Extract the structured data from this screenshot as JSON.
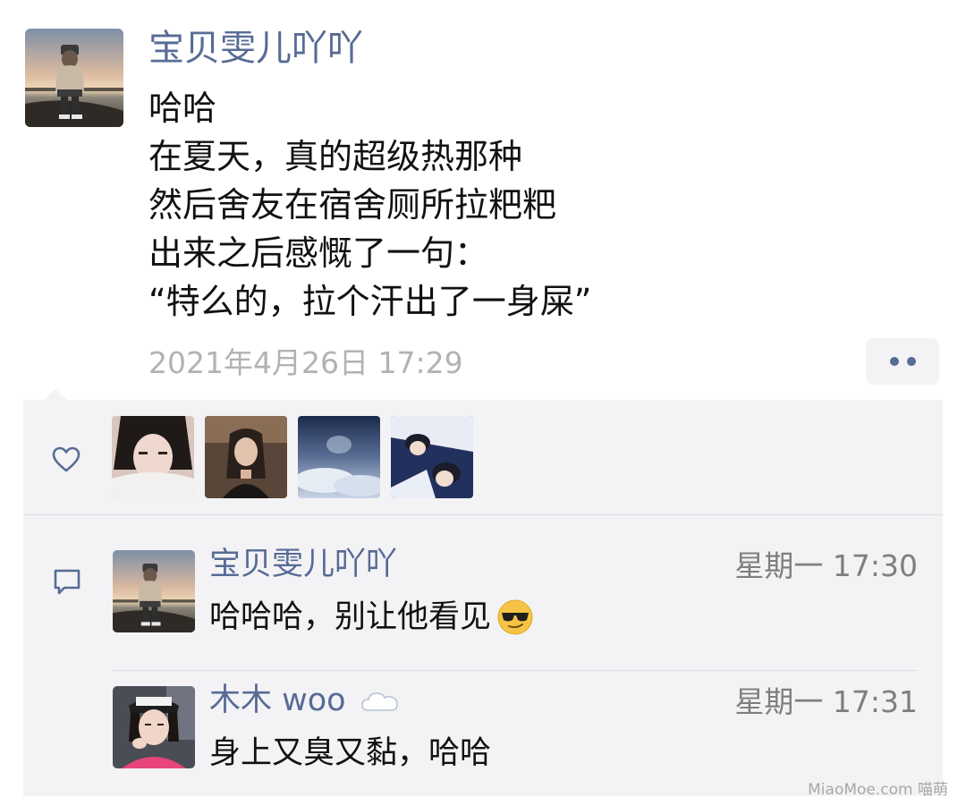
{
  "post": {
    "author": "宝贝雯儿吖吖",
    "lines": [
      "哈哈",
      "在夏天，真的超级热那种",
      "然后舍友在宿舍厕所拉粑粑",
      "出来之后感慨了一句：",
      "“特么的，拉个汗出了一身屎”"
    ],
    "timestamp": "2021年4月26日 17:29"
  },
  "likes": {
    "icon": "heart-icon",
    "avatars": [
      "like-avatar-1",
      "like-avatar-2",
      "like-avatar-3",
      "like-avatar-4"
    ]
  },
  "comments": [
    {
      "name": "宝贝雯儿吖吖",
      "time": "星期一 17:30",
      "text": "哈哈哈，别让他看见",
      "emoji": "sunglasses-emoji"
    },
    {
      "name": "木木 woo",
      "name_icon": "cloud-icon",
      "time": "星期一 17:31",
      "text": "身上又臭又黏，哈哈"
    }
  ],
  "watermark": "MiaoMoe.com 喵萌",
  "colors": {
    "name_link": "#576b95",
    "panel_bg": "#f3f3f5",
    "timestamp": "#b2b2b2",
    "comment_time": "#7f7f7f",
    "divider": "#dedee2"
  }
}
